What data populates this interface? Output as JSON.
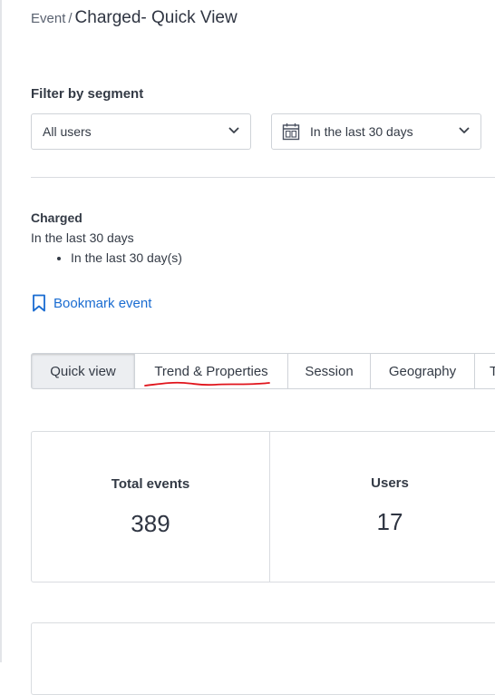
{
  "breadcrumb": {
    "parent": "Event",
    "separator": "/",
    "title": "Charged- Quick View"
  },
  "filter": {
    "label": "Filter by segment",
    "segment_value": "All users",
    "date_value": "In the last 30 days"
  },
  "event": {
    "name": "Charged",
    "range": "In the last 30 days",
    "bullets": [
      "In the last 30 day(s)"
    ],
    "bookmark_label": "Bookmark event"
  },
  "tabs": [
    {
      "label": "Quick view",
      "active": true
    },
    {
      "label": "Trend & Properties",
      "active": false,
      "annotated": true
    },
    {
      "label": "Session",
      "active": false
    },
    {
      "label": "Geography",
      "active": false
    },
    {
      "label": "T",
      "active": false
    }
  ],
  "stats": [
    {
      "label": "Total events",
      "value": "389"
    },
    {
      "label": "Users",
      "value": "17"
    }
  ],
  "colors": {
    "link": "#1a6cd1",
    "annotation": "#e0141c",
    "border": "#cfd3d8",
    "text": "#333a45"
  },
  "icons": {
    "date": "calendar-icon",
    "bookmark": "bookmark-icon",
    "dropdown": "chevron-down-icon"
  }
}
